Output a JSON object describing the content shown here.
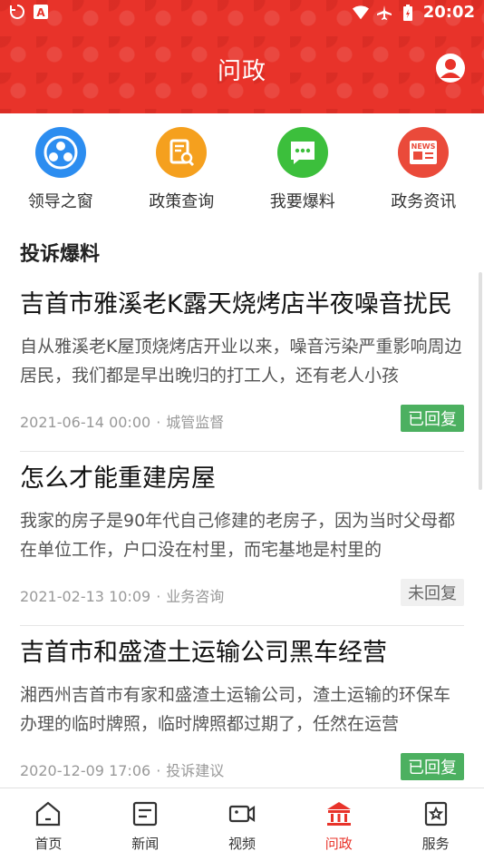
{
  "status_bar": {
    "time": "20:02"
  },
  "header": {
    "title": "问政"
  },
  "quick_menu": [
    {
      "label": "领导之窗",
      "icon": "people-group-icon",
      "color": "#2c8df0"
    },
    {
      "label": "政策查询",
      "icon": "document-search-icon",
      "color": "#f5a01e"
    },
    {
      "label": "我要爆料",
      "icon": "chat-bubble-icon",
      "color": "#3cbf3c"
    },
    {
      "label": "政务资讯",
      "icon": "newspaper-icon",
      "color": "#ea4a3a",
      "icon_text": "NEWS"
    }
  ],
  "section": {
    "title": "投诉爆料"
  },
  "items": [
    {
      "title": "吉首市雅溪老K露天烧烤店半夜噪音扰民",
      "desc": "自从雅溪老K屋顶烧烤店开业以来，噪音污染严重影响周边居民，我们都是早出晚归的打工人，还有老人小孩",
      "date": "2021-06-14 00:00",
      "category": "城管监督",
      "status": "已回复"
    },
    {
      "title": "怎么才能重建房屋",
      "desc": "我家的房子是90年代自己修建的老房子，因为当时父母都在单位工作，户口没在村里，而宅基地是村里的",
      "date": "2021-02-13 10:09",
      "category": "业务咨询",
      "status": "未回复"
    },
    {
      "title": "吉首市和盛渣土运输公司黑车经营",
      "desc": "湘西州吉首市有家和盛渣土运输公司，渣土运输的环保车办理的临时牌照，临时牌照都过期了，任然在运营",
      "date": "2020-12-09 17:06",
      "category": "投诉建议",
      "status": "已回复"
    }
  ],
  "bottom_nav": [
    {
      "label": "首页",
      "icon": "home-icon"
    },
    {
      "label": "新闻",
      "icon": "news-icon"
    },
    {
      "label": "视频",
      "icon": "video-icon"
    },
    {
      "label": "问政",
      "icon": "government-icon",
      "active": true
    },
    {
      "label": "服务",
      "icon": "service-icon"
    }
  ],
  "colors": {
    "brand": "#e8332a",
    "replied": "#4cb060",
    "pending_bg": "#f0f0f0"
  }
}
